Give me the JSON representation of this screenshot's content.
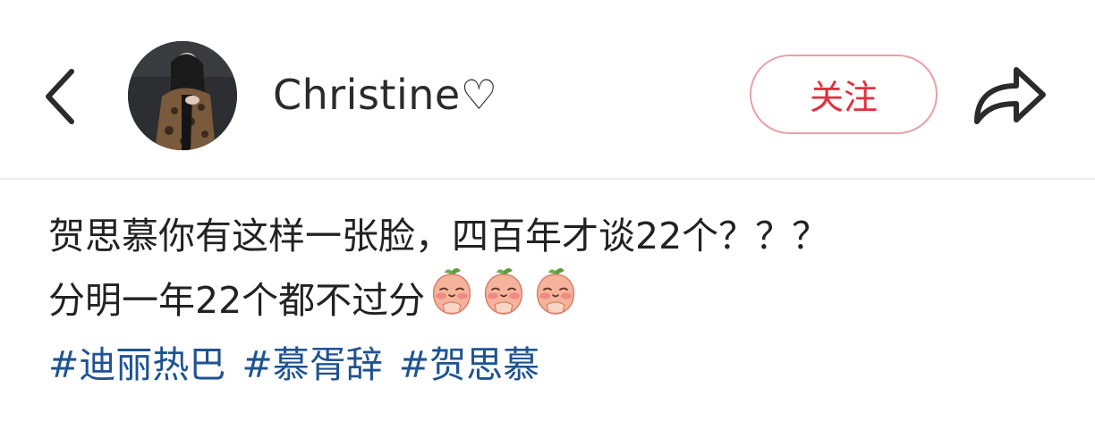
{
  "header": {
    "username": "Christine♡",
    "follow_label": "关注"
  },
  "icons": {
    "back": "chevron-left-icon",
    "share": "share-arrow-icon",
    "emoji": "blushing-peach-emoji"
  },
  "post": {
    "line1": "贺思慕你有这样一张脸，四百年才谈22个？？？",
    "line2": "分明一年22个都不过分",
    "emoji_count": 3,
    "hashtags": [
      "#迪丽热巴",
      "#慕胥辞",
      "#贺思慕"
    ]
  },
  "colors": {
    "follow_text": "#e0303d",
    "follow_border": "#e8a1a6",
    "hashtag": "#1f5391",
    "text": "#222222"
  }
}
